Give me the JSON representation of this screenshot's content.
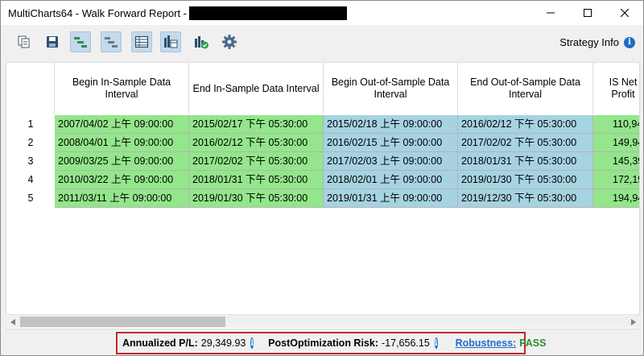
{
  "window": {
    "title": "MultiCharts64 - Walk Forward Report -",
    "controls": [
      "minimize",
      "maximize",
      "close"
    ]
  },
  "toolbar": {
    "icons": [
      {
        "name": "copy-icon",
        "active": false
      },
      {
        "name": "save-icon",
        "active": false
      },
      {
        "name": "gantt-in-sample-icon",
        "active": true
      },
      {
        "name": "gantt-out-of-sample-icon",
        "active": true
      },
      {
        "name": "table-view-icon",
        "active": true
      },
      {
        "name": "chart-calendar-icon",
        "active": true
      },
      {
        "name": "chart-check-icon",
        "active": false
      },
      {
        "name": "gear-icon",
        "active": false
      }
    ],
    "strategy_info_label": "Strategy Info",
    "info_glyph": "i"
  },
  "table": {
    "headers": [
      "Begin In-Sample Data Interval",
      "End In-Sample Data Interval",
      "Begin Out-of-Sample Data Interval",
      "End Out-of-Sample Data Interval",
      "IS Net Profit"
    ],
    "rows": [
      {
        "n": "1",
        "cells": [
          "2007/04/02 上午 09:00:00",
          "2015/02/17 下午 05:30:00",
          "2015/02/18 上午 09:00:00",
          "2016/02/12 下午 05:30:00",
          "110,94"
        ]
      },
      {
        "n": "2",
        "cells": [
          "2008/04/01 上午 09:00:00",
          "2016/02/12 下午 05:30:00",
          "2016/02/15 上午 09:00:00",
          "2017/02/02 下午 05:30:00",
          "149,94"
        ]
      },
      {
        "n": "3",
        "cells": [
          "2009/03/25 上午 09:00:00",
          "2017/02/02 下午 05:30:00",
          "2017/02/03 上午 09:00:00",
          "2018/01/31 下午 05:30:00",
          "145,39"
        ]
      },
      {
        "n": "4",
        "cells": [
          "2010/03/22 上午 09:00:00",
          "2018/01/31 下午 05:30:00",
          "2018/02/01 上午 09:00:00",
          "2019/01/30 下午 05:30:00",
          "172,19"
        ]
      },
      {
        "n": "5",
        "cells": [
          "2011/03/11 上午 09:00:00",
          "2019/01/30 下午 05:30:00",
          "2019/01/31 上午 09:00:00",
          "2019/12/30 下午 05:30:00",
          "194,94"
        ]
      }
    ]
  },
  "status": {
    "annualized_label": "Annualized P/L:",
    "annualized_value": "29,349.93",
    "risk_label": "PostOptimization Risk:",
    "risk_value": "-17,656.15",
    "robustness_label": "Robustness:",
    "robustness_value": "PASS",
    "info_glyph": "i"
  },
  "colors": {
    "in_sample": "#93e68b",
    "out_of_sample": "#a6d3e2",
    "highlight_border": "#c0282d",
    "link_blue": "#1e6ec8",
    "pass_green": "#2e8b2e"
  }
}
